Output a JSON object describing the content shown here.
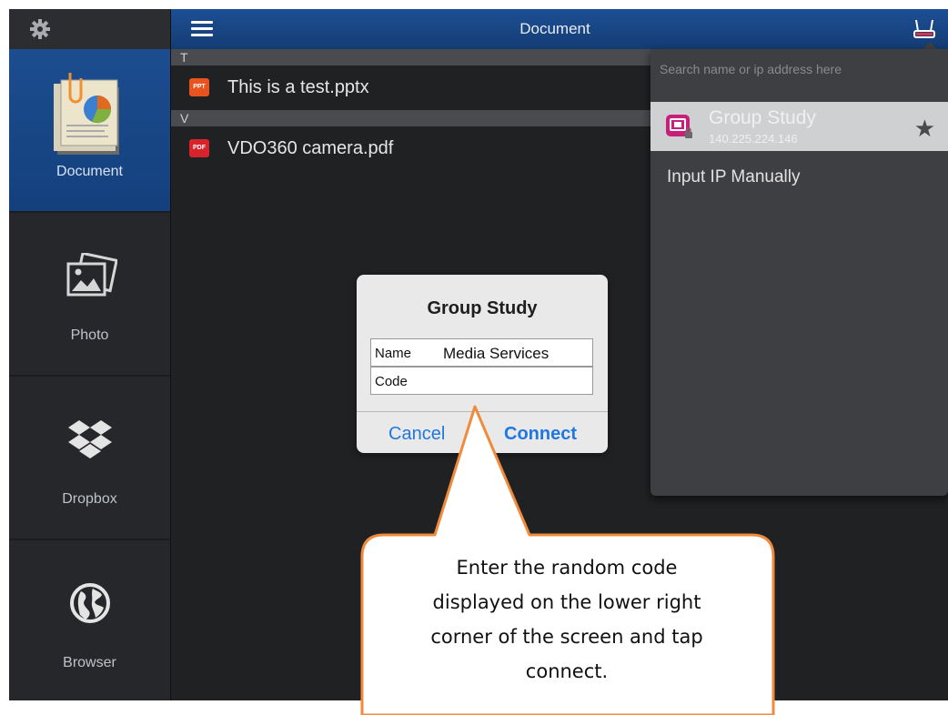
{
  "header": {
    "title": "Document",
    "settings_icon": "gear-icon",
    "menu_icon": "hamburger-menu-icon",
    "receiver_icon": "router-icon"
  },
  "sidebar": {
    "items": [
      {
        "label": "Document",
        "icon": "document-icon",
        "active": true
      },
      {
        "label": "Photo",
        "icon": "photo-icon",
        "active": false
      },
      {
        "label": "Dropbox",
        "icon": "dropbox-icon",
        "active": false
      },
      {
        "label": "Browser",
        "icon": "globe-icon",
        "active": false
      }
    ]
  },
  "file_list": {
    "sections": [
      {
        "header": "T",
        "files": [
          {
            "name": "This is a test.pptx",
            "badge": "PPT",
            "badge_color": "#e8531f"
          }
        ]
      },
      {
        "header": "V",
        "files": [
          {
            "name": "VDO360 camera.pdf",
            "badge": "PDF",
            "badge_color": "#d8232a"
          }
        ]
      }
    ]
  },
  "device_panel": {
    "search_placeholder": "Search name or ip address here",
    "device": {
      "name": "Group Study",
      "ip": "140.225.224.146",
      "icon": "display-lock-icon",
      "favorite_icon": "star-icon"
    },
    "manual_option": "Input IP Manually"
  },
  "dialog": {
    "title": "Group Study",
    "name_label": "Name",
    "name_value": "Media Services",
    "code_label": "Code",
    "code_value": "",
    "cancel": "Cancel",
    "connect": "Connect"
  },
  "callout": {
    "lines": [
      "Enter the random code",
      "displayed on the lower right",
      "corner of the screen and tap",
      "connect."
    ],
    "border_color": "#f08a3c"
  },
  "colors": {
    "accent_blue": "#1c4d8f",
    "link_blue": "#2077e0"
  }
}
